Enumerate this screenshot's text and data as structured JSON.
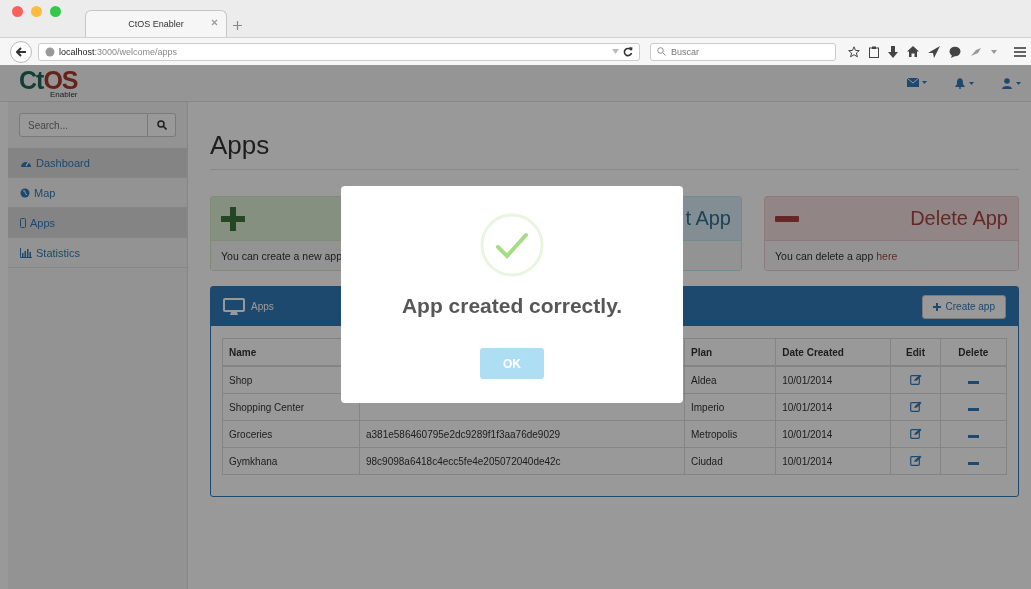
{
  "browser": {
    "tab_title": "CtOS Enabler",
    "url_host": "localhost",
    "url_path": ":3000/welcome/apps",
    "search_placeholder": "Buscar"
  },
  "logo": {
    "parts": [
      "Ct",
      "OS"
    ],
    "subtitle": "Enabler"
  },
  "sidebar": {
    "search_placeholder": "Search...",
    "items": [
      {
        "label": "Dashboard",
        "selected": true
      },
      {
        "label": "Map",
        "selected": false
      },
      {
        "label": "Apps",
        "selected": true
      },
      {
        "label": "Statistics",
        "selected": false
      }
    ]
  },
  "page_title": "Apps",
  "panels": [
    {
      "kind": "create",
      "text": "You can create a new app"
    },
    {
      "kind": "edit",
      "title": "t App"
    },
    {
      "kind": "delete",
      "title": "Delete App",
      "text": "You can delete a app ",
      "link": "here"
    }
  ],
  "apps_panel": {
    "title": "Apps",
    "button": "Create app",
    "table": {
      "columns": [
        "Name",
        "Plan",
        "Date Created",
        "Edit",
        "Delete"
      ],
      "rows": [
        {
          "name": "Shop",
          "plan": "Aldea",
          "date": "10/01/2014"
        },
        {
          "name": "Shopping Center",
          "plan": "Imperio",
          "date": "10/01/2014"
        },
        {
          "name": "Groceries",
          "key": "a381e586460795e2dc9289f1f3aa76de9029",
          "plan": "Metropolis",
          "date": "10/01/2014"
        },
        {
          "name": "Gymkhana",
          "key": "98c9098a6418c4ecc5fe4e205072040de42c",
          "plan": "Ciudad",
          "date": "10/01/2014"
        }
      ]
    }
  },
  "modal": {
    "title": "App created correctly.",
    "button": "OK"
  }
}
